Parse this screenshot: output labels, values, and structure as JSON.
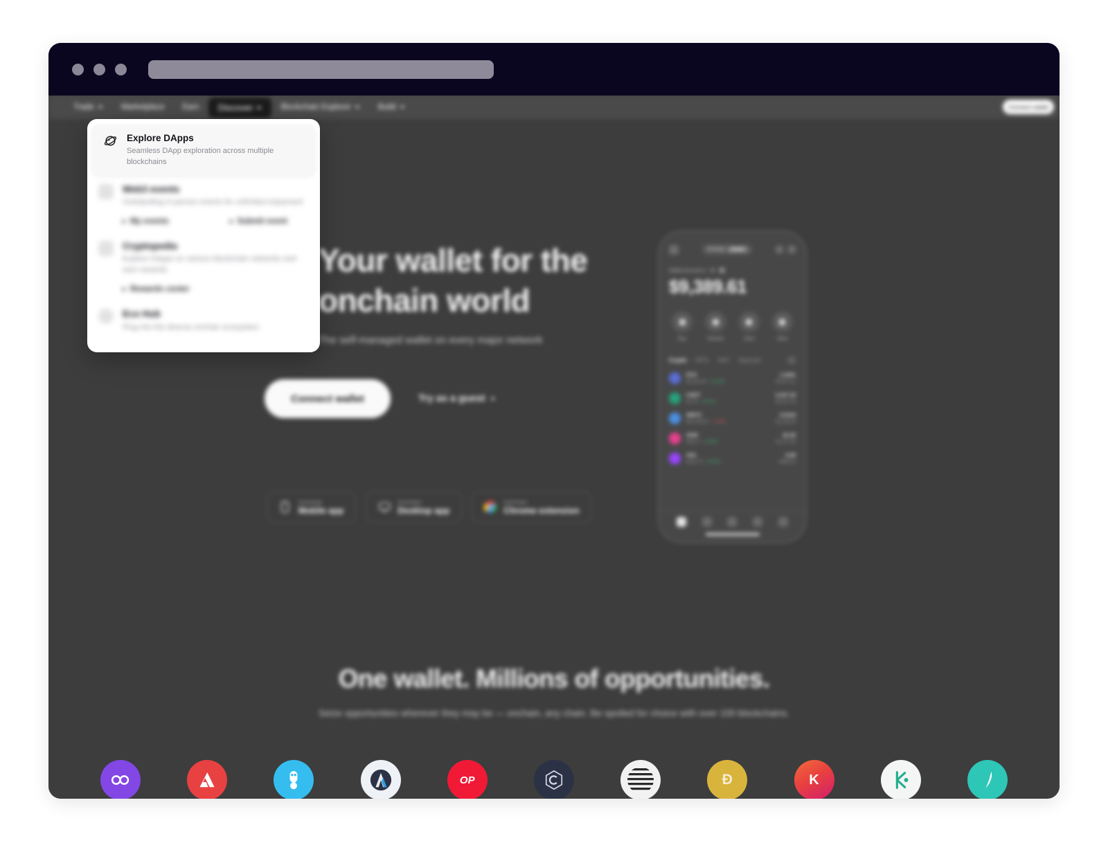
{
  "browser": {
    "url_value": "",
    "traffic_lights": [
      "close-dot",
      "minimize-dot",
      "maximize-dot"
    ]
  },
  "nav": {
    "items": [
      {
        "label": "Trade",
        "has_caret": true,
        "active": false
      },
      {
        "label": "Marketplace",
        "has_caret": false,
        "active": false
      },
      {
        "label": "Earn",
        "has_caret": false,
        "active": false
      },
      {
        "label": "Discover",
        "has_caret": true,
        "caret_dir": "up",
        "active": true
      },
      {
        "label": "Blockchain Explorer",
        "has_caret": true,
        "active": false
      },
      {
        "label": "Build",
        "has_caret": true,
        "active": false
      }
    ],
    "connect_label": "Connect wallet"
  },
  "dropdown": {
    "items": [
      {
        "title": "Explore DApps",
        "desc": "Seamless DApp exploration across multiple blockchains",
        "icon": "planet-icon",
        "active": true,
        "sublinks": []
      },
      {
        "title": "Web3 events",
        "desc": "Outstanding in-person events for unlimited enjoyment",
        "icon": "calendar-icon",
        "active": false,
        "sublinks": [
          "My events",
          "Submit event"
        ]
      },
      {
        "title": "Cryptopedia",
        "desc": "Explore DApps on various blockchain networks and earn rewards",
        "icon": "book-icon",
        "active": false,
        "sublinks": [
          "Rewards center"
        ]
      },
      {
        "title": "Eco Hub",
        "desc": "Plug into the diverse onchain ecosystem",
        "icon": "globe-icon",
        "active": false,
        "sublinks": []
      }
    ]
  },
  "hero": {
    "title_line1": "Your wallet for the",
    "title_line2": "onchain world",
    "subtitle": "The self-managed wallet on every major network",
    "connect_label": "Connect wallet",
    "guest_label": "Try as a guest",
    "downloads": [
      {
        "small": "Download",
        "big": "Mobile app",
        "icon": "phone-icon"
      },
      {
        "small": "Download",
        "big": "Desktop app",
        "icon": "desktop-icon"
      },
      {
        "small": "Download",
        "big": "Chrome extension",
        "icon": "chrome-icon"
      }
    ]
  },
  "phone": {
    "network_chip": "Onchain",
    "network_badge": "Mode",
    "account_label": "Web3 Account 1",
    "balance": "$9,389.61",
    "actions": [
      {
        "label": "Buy",
        "icon": "plus-icon"
      },
      {
        "label": "Receive",
        "icon": "arrow-down-icon"
      },
      {
        "label": "Send",
        "icon": "arrow-up-icon"
      },
      {
        "label": "More",
        "icon": "dots-icon"
      }
    ],
    "tabs": [
      "Crypto",
      "NFTs",
      "DeFi",
      "Approval"
    ],
    "selected_tab": "Crypto",
    "tokens": [
      {
        "symbol": "ETH",
        "price": "$2,318.45",
        "change": "+2.31%",
        "dir": "up",
        "amount": "1.2391",
        "value": "$2,872.11",
        "color": "#5b6dd8"
      },
      {
        "symbol": "USDT",
        "price": "$1.00",
        "change": "+0.01%",
        "dir": "up",
        "amount": "3,107.18",
        "value": "$3,107.18",
        "color": "#26a17b"
      },
      {
        "symbol": "WBTC",
        "price": "$61,208.00",
        "change": "-1.08%",
        "dir": "down",
        "amount": "0.0218",
        "value": "$1,334.34",
        "color": "#4a90e2"
      },
      {
        "symbol": "OKB",
        "price": "$48.11",
        "change": "+0.92%",
        "dir": "up",
        "amount": "22.40",
        "value": "$1,077.66",
        "color": "#e8418f"
      },
      {
        "symbol": "SOL",
        "price": "$142.70",
        "change": "+4.02%",
        "dir": "up",
        "amount": "6.98",
        "value": "$996.04",
        "color": "#9945ff"
      }
    ]
  },
  "opportunities": {
    "title": "One wallet. Millions of opportunities.",
    "subtitle": "Seize opportunities wherever they may be — onchain, any chain. Be spoiled for choice with over 100 blockchains."
  },
  "chains": [
    {
      "name": "polygon",
      "color": "#8247e5",
      "glyph": "∞"
    },
    {
      "name": "avalanche",
      "color": "#e84142",
      "glyph": "A"
    },
    {
      "name": "bnb-chain",
      "color": "#35bdef",
      "glyph": "⬙"
    },
    {
      "name": "arbitrum",
      "color": "#e8eaee",
      "glyph": "◈"
    },
    {
      "name": "optimism",
      "color": "#f01a37",
      "glyph": "OP"
    },
    {
      "name": "core",
      "color": "#2b3245",
      "glyph": "C"
    },
    {
      "name": "stellar",
      "color": "#f2f2f2",
      "glyph": "≋"
    },
    {
      "name": "dogecoin",
      "color": "#d9b43c",
      "glyph": "Ð"
    },
    {
      "name": "klaytn",
      "color": "#e8413f",
      "glyph": "K"
    },
    {
      "name": "kucoin-chain",
      "color": "#f4f6f5",
      "glyph": "K"
    },
    {
      "name": "conflux",
      "color": "#2ec6b6",
      "glyph": "✧"
    }
  ],
  "colors": {
    "page_bg": "#ffffff",
    "titlebar": "#0b0620",
    "site_bg": "#3d3d3d",
    "navbar": "#4a4a4a",
    "active_pill": "#1b1b1b",
    "dropdown_bg": "#ffffff",
    "accent_text": "#14141a"
  }
}
